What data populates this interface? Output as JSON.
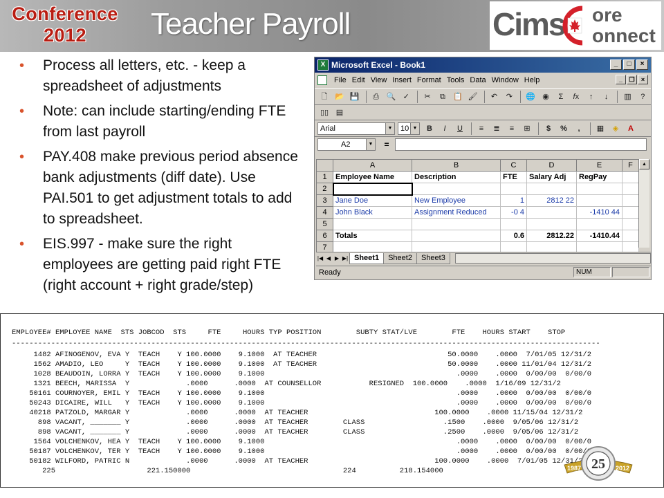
{
  "banner": {
    "conference_line1": "Conference",
    "conference_line2": "2012",
    "title": "Teacher Payroll",
    "right_logo": {
      "cims": "Cims",
      "core": "ore",
      "connect": "onnect",
      "icon": "maple-leaf-flag-icon"
    }
  },
  "bullets": [
    "Process all letters, etc. - keep a spreadsheet of adjustments",
    "Note: can include starting/ending FTE from last payroll",
    "PAY.408 make previous period absence bank adjustments (diff date). Use PAI.501 to get adjustment totals to add to spreadsheet.",
    "EIS.997 - make sure the right employees are getting paid right FTE (right account + right grade/step)"
  ],
  "excel": {
    "title": "Microsoft Excel - Book1",
    "menu": [
      "File",
      "Edit",
      "View",
      "Insert",
      "Format",
      "Tools",
      "Data",
      "Window",
      "Help"
    ],
    "font_name": "Arial",
    "font_size": "10",
    "name_box": "A2",
    "formula_eq": "=",
    "columns": [
      "A",
      "B",
      "C",
      "D",
      "E",
      "F"
    ],
    "rows": [
      {
        "n": "1",
        "cells": [
          "Employee Name",
          "Description",
          "FTE",
          "Salary Adj",
          "RegPay",
          ""
        ]
      },
      {
        "n": "2",
        "cells": [
          "",
          "",
          "",
          "",
          "",
          ""
        ]
      },
      {
        "n": "3",
        "cells": [
          "Jane Doe",
          "New Employee",
          "1",
          "2812 22",
          "",
          ""
        ]
      },
      {
        "n": "4",
        "cells": [
          "John Black",
          "Assignment Reduced",
          "-0 4",
          "",
          "-1410 44",
          ""
        ]
      },
      {
        "n": "5",
        "cells": [
          "",
          "",
          "",
          "",
          "",
          ""
        ]
      },
      {
        "n": "6",
        "cells": [
          "Totals",
          "",
          "0.6",
          "2812.22",
          "-1410.44",
          ""
        ]
      },
      {
        "n": "7",
        "cells": [
          "",
          "",
          "",
          "",
          "",
          ""
        ]
      }
    ],
    "sheets": [
      "Sheet1",
      "Sheet2",
      "Sheet3"
    ],
    "status_ready": "Ready",
    "status_num": "NUM"
  },
  "report": {
    "header": "EMPLOYEE# EMPLOYEE NAME  STS JOBCOD  STS     FTE     HOURS TYP POSITION        SUBTY STAT/LVE        FTE    HOURS START    STOP",
    "rule": "---------------------------------------------------------------------------------------------------------------------------------------",
    "lines": [
      "     1482 AFINOGENOV, EVA Y  TEACH    Y 100.0000    9.1000  AT TEACHER                              50.0000    .0000  7/01/05 12/31/2",
      "     1562 AMADIO, LEO     Y  TEACH    Y 100.0000    9.1000  AT TEACHER                              50.0000    .0000 11/01/04 12/31/2",
      "     1028 BEAUDOIN, LORRA Y  TEACH    Y 100.0000    9.1000                                            .0000    .0000  0/00/00  0/00/0",
      "     1321 BEECH, MARISSA  Y             .0000      .0000  AT COUNSELLOR           RESIGNED  100.0000    .0000  1/16/09 12/31/2",
      "    50161 COURNOYER, EMIL Y  TEACH    Y 100.0000    9.1000                                            .0000    .0000  0/00/00  0/00/0",
      "    50243 DICAIRE, WILL   Y  TEACH    Y 100.0000    9.1000                                            .0000    .0000  0/00/00  0/00/0",
      "    40218 PATZOLD, MARGAR Y             .0000      .0000  AT TEACHER                             100.0000    .0000 11/15/04 12/31/2",
      "      898 VACANT, _______ Y             .0000      .0000  AT TEACHER        CLASS                  .1500    .0000  9/05/06 12/31/2",
      "      898 VACANT, _______ Y             .0000      .0000  AT TEACHER        CLASS                  .2500    .0000  9/05/06 12/31/2",
      "     1564 VOLCHENKOV, HEA Y  TEACH    Y 100.0000    9.1000                                            .0000    .0000  0/00/00  0/00/0",
      "    50187 VOLCHENKOV, TER Y  TEACH    Y 100.0000    9.1000                                            .0000    .0000  0/00/00  0/00/0",
      "    50182 WILFORD, PATRIC N             .0000      .0000  AT TEACHER                             100.0000    .0000  7/01/05 12/31/2"
    ],
    "totals": "       225                     221.150000                                   224          218.154000"
  },
  "seal": {
    "years": "1987",
    "year_end": "2012",
    "number": "25"
  },
  "colors": {
    "accent": "#b91d12",
    "bullet": "#d9532c",
    "title_bar": "#0a246a"
  }
}
